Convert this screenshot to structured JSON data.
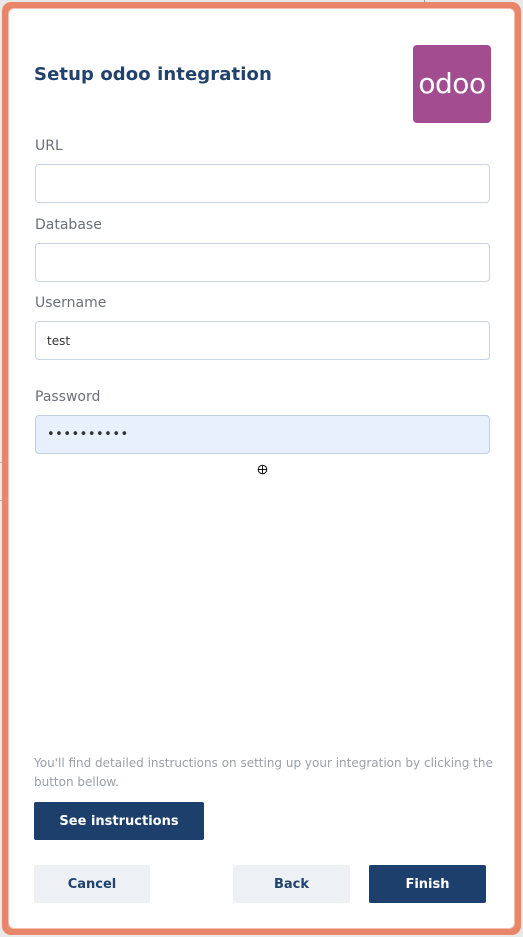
{
  "dialog": {
    "title": "Setup odoo integration",
    "logo_text": "odoo",
    "logo_icon": "odoo-logo",
    "accent_color": "#1d3f6c",
    "logo_color": "#a24d8f"
  },
  "form": {
    "url": {
      "label": "URL",
      "value": ""
    },
    "database": {
      "label": "Database",
      "value": ""
    },
    "username": {
      "label": "Username",
      "value": "test"
    },
    "password": {
      "label": "Password",
      "value": "••••••••••"
    }
  },
  "help": {
    "text": "You'll find detailed instructions on setting up your integration by clicking the button bellow.",
    "button_label": "See instructions"
  },
  "footer": {
    "cancel_label": "Cancel",
    "back_label": "Back",
    "finish_label": "Finish"
  }
}
